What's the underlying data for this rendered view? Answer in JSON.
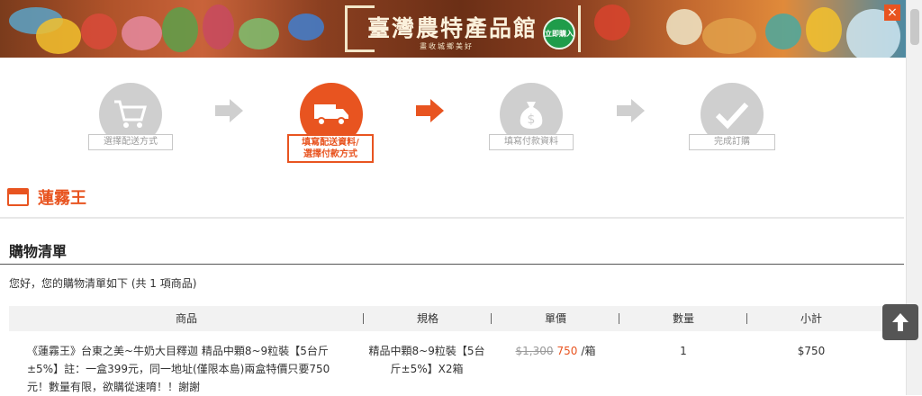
{
  "banner": {
    "title": "臺灣農特產品館",
    "subtitle": "畫收城鄉美好",
    "badge": "立即購入",
    "close": "×"
  },
  "steps": [
    {
      "label": "選擇配送方式",
      "icon": "cart-icon",
      "active": false
    },
    {
      "label": "填寫配送資料/選擇付款方式",
      "icon": "truck-icon",
      "active": true
    },
    {
      "label": "填寫付款資料",
      "icon": "money-bag-icon",
      "active": false
    },
    {
      "label": "完成訂購",
      "icon": "check-icon",
      "active": false
    }
  ],
  "step_active_line1": "填寫配送資料/",
  "step_active_line2": "選擇付款方式",
  "store": {
    "name": "蓮霧王"
  },
  "cart": {
    "title": "購物清單",
    "greeting": "您好，您的購物清單如下 (共 1 項商品)"
  },
  "table": {
    "headers": [
      "商品",
      "規格",
      "單價",
      "數量",
      "小計"
    ],
    "row": {
      "product": "《蓮霧王》台東之美~牛奶大目釋迦 精品中顆8~9粒裝【5台斤±5%】註：一盒399元，同一地址(僅限本島)兩盒特價只要750元！數量有限，欲購從速唷！！謝謝",
      "spec": "精品中顆8~9粒裝【5台斤±5%】X2箱",
      "price_old": "$1,300",
      "price_new": "750",
      "price_unit": "/箱",
      "quantity": "1",
      "subtotal": "$750"
    }
  },
  "colors": {
    "accent": "#e85420",
    "inactive": "#cfcfcf"
  }
}
